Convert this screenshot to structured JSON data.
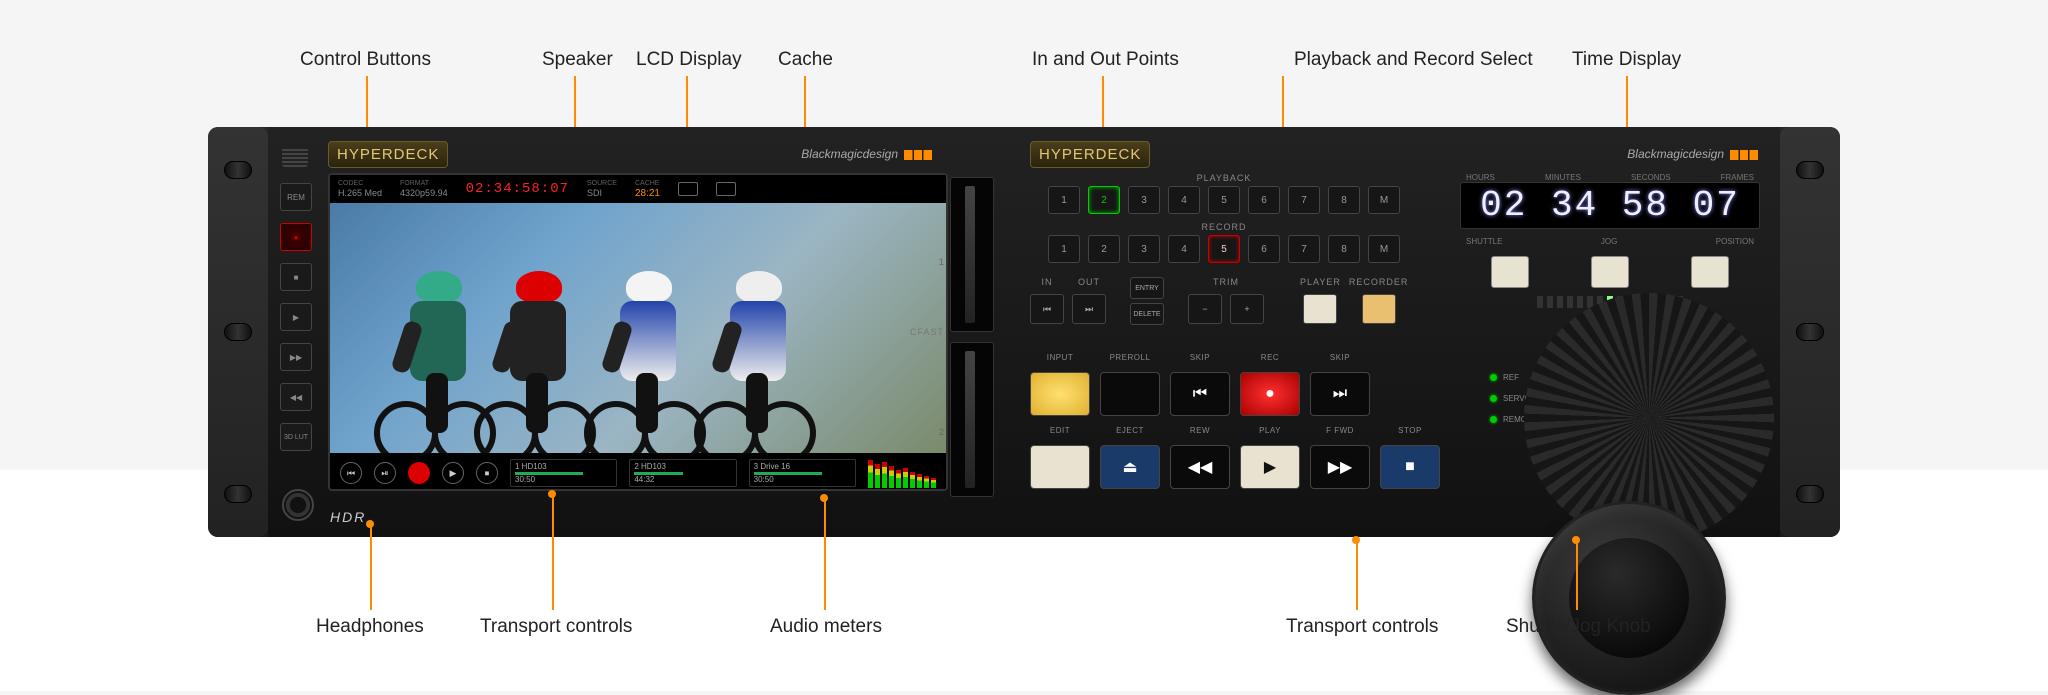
{
  "annotations": {
    "top": {
      "control_buttons": "Control Buttons",
      "speaker": "Speaker",
      "lcd_display": "LCD Display",
      "cache": "Cache",
      "in_out": "In and Out Points",
      "pb_rec": "Playback and Record Select",
      "time_display": "Time Display"
    },
    "bottom": {
      "headphones": "Headphones",
      "transport_l": "Transport controls",
      "audio_meters": "Audio meters",
      "transport_r": "Transport controls",
      "shuttle_jog": "Shuttle/Jog Knob"
    }
  },
  "leftModule": {
    "badge": "HYPERDECK",
    "brand": "Blackmagicdesign",
    "hdr": "HDR",
    "control_buttons": [
      "REM",
      "●",
      "■",
      "▶",
      "▶▶",
      "◀◀",
      "3D LUT"
    ],
    "cfast": {
      "label": "CFAST",
      "slots": [
        "1",
        "2"
      ]
    },
    "lcd": {
      "top": {
        "codec_lbl": "CODEC",
        "codec": "H.265 Med",
        "format_lbl": "FORMAT",
        "format": "4320p59.94",
        "timecode": "02:34:58:07",
        "source_lbl": "SOURCE",
        "source": "SDI",
        "cache_lbl": "CACHE",
        "cache": "28:21"
      },
      "transport_icons": [
        "⏮",
        "⏯",
        "●",
        "▶",
        "⏹"
      ],
      "drives": [
        {
          "name": "1 HD103",
          "time": "30:50"
        },
        {
          "name": "2 HD103",
          "time": "44:32"
        },
        {
          "name": "3 Drive 16",
          "time": "30:50"
        }
      ]
    }
  },
  "rightModule": {
    "badge": "HYPERDECK",
    "brand": "Blackmagicdesign",
    "playback": {
      "label": "PLAYBACK",
      "buttons": [
        "1",
        "2",
        "3",
        "4",
        "5",
        "6",
        "7",
        "8",
        "M"
      ]
    },
    "record": {
      "label": "RECORD",
      "buttons": [
        "1",
        "2",
        "3",
        "4",
        "5",
        "6",
        "7",
        "8",
        "M"
      ]
    },
    "inout": {
      "in": "IN",
      "out": "OUT",
      "entry": "ENTRY",
      "delete": "DELETE",
      "trim": "TRIM",
      "player": "PLAYER",
      "recorder": "RECORDER"
    },
    "time": {
      "labels": [
        "HOURS",
        "MINUTES",
        "SECONDS",
        "FRAMES"
      ],
      "value": "02 34 58 07",
      "sjp": [
        "SHUTTLE",
        "JOG",
        "POSITION"
      ]
    },
    "status": [
      "REF",
      "SERVO",
      "REMOTE"
    ],
    "transport": {
      "row1_labels": [
        "INPUT",
        "PREROLL",
        "SKIP",
        "REC",
        "SKIP"
      ],
      "row1_icons": [
        "",
        "",
        "⏮",
        "●",
        "⏭"
      ],
      "row2_labels": [
        "EDIT",
        "EJECT",
        "REW",
        "PLAY",
        "F FWD",
        "STOP"
      ],
      "row2_icons": [
        "",
        "⏏",
        "◀◀",
        "▶",
        "▶▶",
        "■"
      ]
    }
  }
}
